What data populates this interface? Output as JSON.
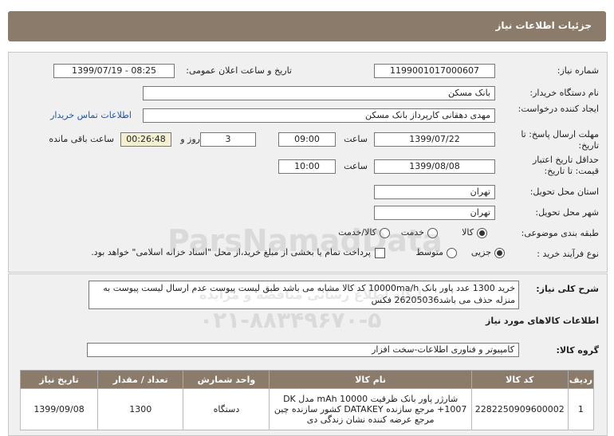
{
  "header": {
    "title": "جزئیات اطلاعات نیاز"
  },
  "fields": {
    "need_number_label": "شماره نیاز:",
    "need_number": "1199001017000607",
    "announce_label": "تاریخ و ساعت اعلان عمومی:",
    "announce_value": "1399/07/19 - 08:25",
    "buyer_label": "نام دستگاه خریدار:",
    "buyer_value": "بانک مسکن",
    "requester_label": "ایجاد کننده درخواست:",
    "requester_value": "مهدی دهقانی کارپرداز بانک مسکن",
    "contact_link": "اطلاعات تماس خریدار",
    "reply_deadline_label": "مهلت ارسال پاسخ: تا تاریخ:",
    "reply_date": "1399/07/22",
    "time_label": "ساعت",
    "reply_time": "09:00",
    "days_value": "3",
    "days_label": "روز و",
    "remaining_time": "00:26:48",
    "remaining_label": "ساعت باقی مانده",
    "price_validity_label": "حداقل تاریخ اعتبار قیمت: تا تاریخ:",
    "validity_date": "1399/08/08",
    "validity_time_label": "ساعت",
    "validity_time": "10:00",
    "province_label": "استان محل تحویل:",
    "province_value": "تهران",
    "city_label": "شهر محل تحویل:",
    "city_value": "تهران",
    "category_label": "طبقه بندی موضوعی:",
    "category_options": [
      "کالا",
      "خدمت",
      "کالا/خدمت"
    ],
    "process_label": "نوع فرآیند خرید :",
    "process_options": [
      "جزیی",
      "متوسط"
    ],
    "payment_note": "پرداخت تمام یا بخشی از مبلغ خرید،از محل \"اسناد خزانه اسلامی\" خواهد بود."
  },
  "description": {
    "label": "شرح کلی نیاز:",
    "text": "خرید 1300 عدد پاور بانک 10000ma/h  کد کالا مشابه می باشد طبق لیست پیوست عدم ارسال لیست پیوست به منزله حذف می باشد26205036 فکس"
  },
  "goods_info_title": "اطلاعات کالاهای مورد نیاز",
  "goods_group": {
    "label": "گروه کالا:",
    "value": "کامپیوتر و فناوری اطلاعات-سخت افزار"
  },
  "table": {
    "headers": [
      "ردیف",
      "کد کالا",
      "نام کالا",
      "واحد شمارش",
      "تعداد / مقدار",
      "تاریخ نیاز"
    ],
    "rows": [
      {
        "row": "1",
        "code": "2282250909600002",
        "name": "شارژر پاور بانک ظرفیت 10000 mAh مدل DK 1007+ مرجع سازنده DATAKEY کشور سازنده چین مرجع عرضه کننده نشان زندگی دی",
        "unit": "دستگاه",
        "qty": "1300",
        "date": "1399/09/08"
      }
    ]
  },
  "watermark": {
    "text": "ParsNamadData",
    "subtitle": "پایگاه اطلاع رسانی مناقصه و مزایده",
    "phone": "۰۲۱-۸۸۳۴۹۶۷۰-۵"
  }
}
